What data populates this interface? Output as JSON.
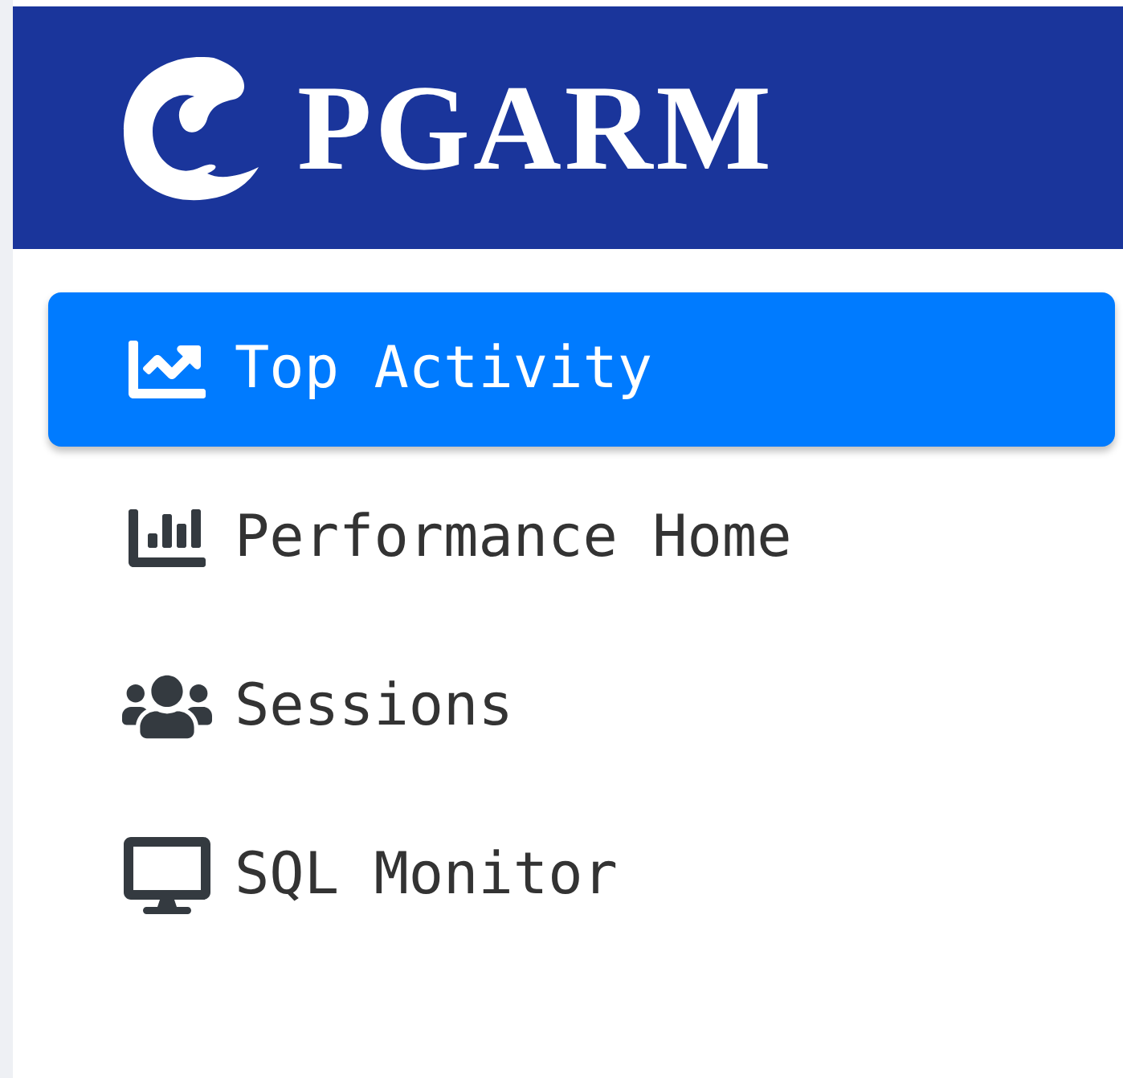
{
  "header": {
    "brand": "PGARM"
  },
  "sidebar": {
    "items": [
      {
        "label": "Top Activity",
        "kind": "line-chart",
        "selected": true
      },
      {
        "label": "Performance Home",
        "kind": "bar-chart",
        "selected": false
      },
      {
        "label": "Sessions",
        "kind": "users",
        "selected": false
      },
      {
        "label": "SQL Monitor",
        "kind": "monitor",
        "selected": false
      }
    ]
  }
}
